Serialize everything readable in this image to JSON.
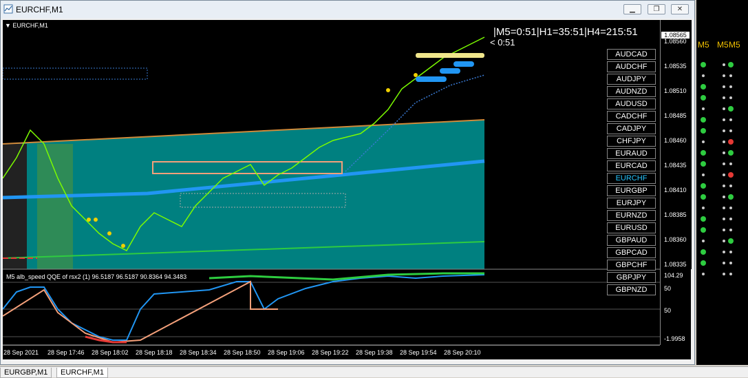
{
  "window": {
    "title": "EURCHF,M1"
  },
  "chart": {
    "symbol_label": "EURCHF,M1",
    "timer_line1": "|M5=0:51|H1=35:51|H4=215:51",
    "timer_line2": "< 0:51",
    "current_price": "1.08565",
    "price_labels": [
      "1.08560",
      "1.08535",
      "1.08510",
      "1.08485",
      "1.08460",
      "1.08435",
      "1.08410",
      "1.08385",
      "1.08360",
      "1.08335"
    ],
    "symbols": [
      "AUDCAD",
      "AUDCHF",
      "AUDJPY",
      "AUDNZD",
      "AUDUSD",
      "CADCHF",
      "CADJPY",
      "CHFJPY",
      "EURAUD",
      "EURCAD",
      "EURCHF",
      "EURGBP",
      "EURJPY",
      "EURNZD",
      "EURUSD",
      "GBPAUD",
      "GBPCAD",
      "GBPCHF",
      "GBPJPY",
      "GBPNZD"
    ],
    "active_symbol": "EURCHF",
    "indicator_title": "M5 alb_speed QQE of rsx2 (1) 96.5187 96.5187 90.8364 94.3483",
    "indicator_axis": [
      "104.29",
      "50",
      "50",
      "-1.9958"
    ],
    "time_labels": [
      "28 Sep 2021",
      "28 Sep 17:46",
      "28 Sep 18:02",
      "28 Sep 18:18",
      "28 Sep 18:34",
      "28 Sep 18:50",
      "28 Sep 19:06",
      "28 Sep 19:22",
      "28 Sep 19:38",
      "28 Sep 19:54",
      "28 Sep 20:10"
    ]
  },
  "right_panel": {
    "headers": [
      "M5",
      "M5",
      "M5"
    ]
  },
  "tabs": [
    {
      "label": "EURGBP,M1",
      "active": false
    },
    {
      "label": "EURCHF,M1",
      "active": true
    }
  ],
  "colors": {
    "teal": "#008080",
    "candle": "#7cfc00",
    "gold": "#d4af37",
    "blue": "#2196f3"
  }
}
